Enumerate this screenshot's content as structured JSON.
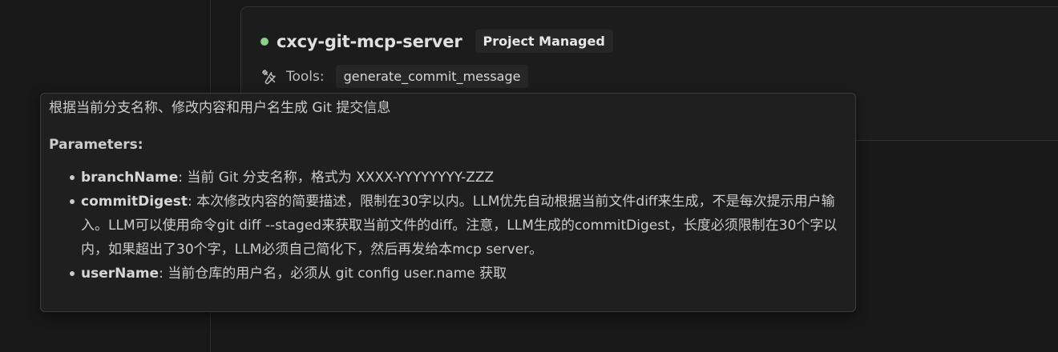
{
  "server": {
    "name": "cxcy-git-mcp-server",
    "badge": "Project Managed",
    "status_color": "#89d185",
    "tools_label": "Tools:",
    "tools": [
      "generate_commit_message"
    ]
  },
  "tooltip": {
    "description": "根据当前分支名称、修改内容和用户名生成 Git 提交信息",
    "parameters_heading": "Parameters:",
    "parameters": [
      {
        "name": "branchName",
        "sep": ": ",
        "text": "当前 Git 分支名称，格式为 XXXX-YYYYYYYY-ZZZ"
      },
      {
        "name": "commitDigest",
        "sep": ": ",
        "text": "本次修改内容的简要描述，限制在30字以内。LLM优先自动根据当前文件diff来生成，不是每次提示用户输入。LLM可以使用命令git diff --staged来获取当前文件的diff。注意，LLM生成的commitDigest，长度必须限制在30个字以内，如果超出了30个字，LLM必须自己简化下，然后再发给本mcp server。"
      },
      {
        "name": "userName",
        "sep": ": ",
        "text": "当前仓库的用户名，必须从 git config user.name 获取"
      }
    ]
  },
  "icons": {
    "tools": "tools-icon"
  }
}
